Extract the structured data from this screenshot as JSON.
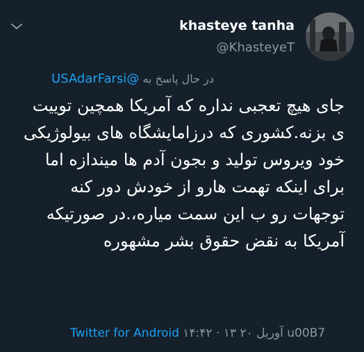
{
  "tweet": {
    "display_name": "khasteye tanha",
    "handle": "@KhasteyeT",
    "replying_to_label": "در حال پاسخ به",
    "replying_to_handle": "@USAdarFarsi",
    "text": "جای هیچ تعجبی نداره که آمریکا همچین توییت ی بزنه.کشوری که درزامایشگاه های بیولوژیکی خود ویروس تولید و بجون آدم ها میندازه اما برای اینکه تهمت هارو از خودش دور کنه توجهات رو ب این سمت میاره،.در صورتیکه آمریکا به نقض حقوق بشر مشهوره",
    "timestamp": "۱۴:۴۲ · ۱۳ آوریل ۲۰ u00B7",
    "source": "Twitter for Android"
  },
  "icons": {
    "menu": "chevron-down-icon",
    "avatar": "avatar"
  },
  "colors": {
    "background": "#15202b",
    "text_primary": "#ffffff",
    "text_secondary": "#8899a6",
    "link": "#1da1f2"
  }
}
